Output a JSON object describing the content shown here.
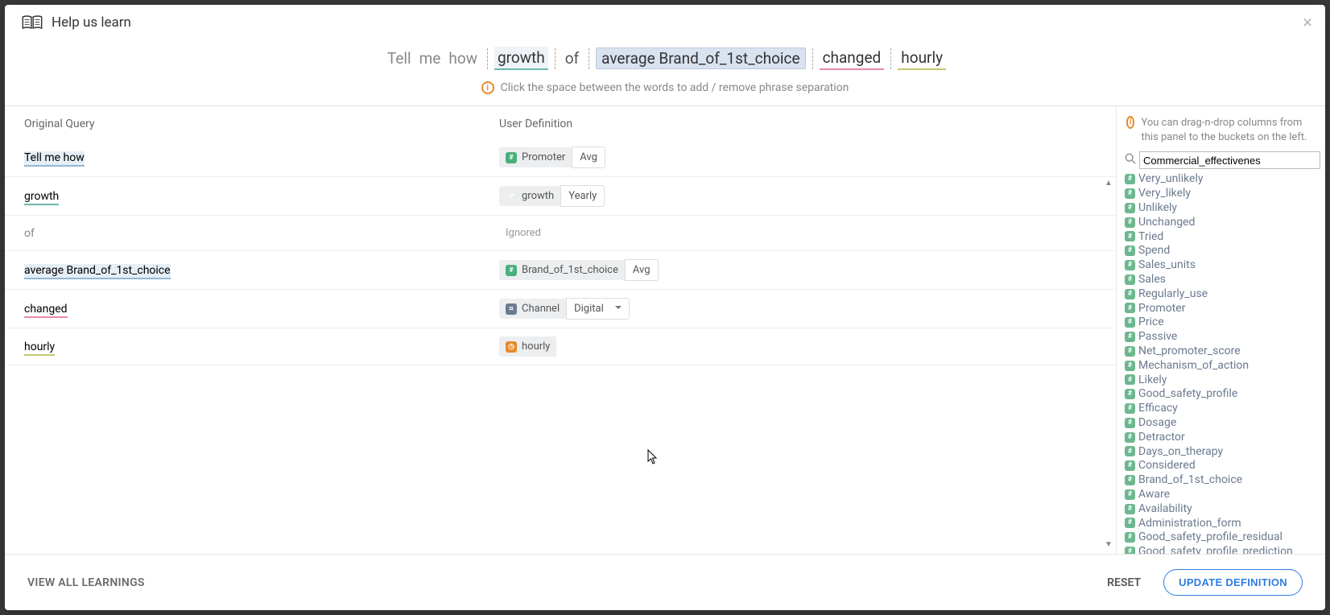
{
  "modal": {
    "title": "Help us learn"
  },
  "query_tokens": {
    "tell": "Tell",
    "me": "me",
    "how": "how",
    "growth": "growth",
    "of": "of",
    "avg": "average  Brand_of_1st_choice",
    "changed": "changed",
    "hourly": "hourly"
  },
  "hint": "Click the space between the words to add / remove phrase separation",
  "headers": {
    "original": "Original Query",
    "user_def": "User Definition"
  },
  "rows": [
    {
      "phrase": "Tell me how",
      "phrase_class": "p-tellme",
      "chip_icon": "i-green",
      "chip_icon_glyph": "#",
      "chip_label": "Promoter",
      "agg": "Avg",
      "agg_caret": false
    },
    {
      "phrase": "growth",
      "phrase_class": "p-growth",
      "chip_icon": "i-chart",
      "chip_icon_glyph": "↗",
      "chip_label": "growth",
      "agg": "Yearly",
      "agg_caret": false
    },
    {
      "phrase": "of",
      "phrase_class": "p-of",
      "ignored": true,
      "ignored_label": "Ignored"
    },
    {
      "phrase": "average Brand_of_1st_choice",
      "phrase_class": "p-avg",
      "chip_icon": "i-green",
      "chip_icon_glyph": "#",
      "chip_label": "Brand_of_1st_choice",
      "agg": "Avg",
      "agg_caret": false
    },
    {
      "phrase": "changed",
      "phrase_class": "p-changed",
      "chip_icon": "i-att",
      "chip_icon_glyph": "⌗",
      "chip_label": "Channel",
      "agg": "Digital",
      "agg_caret": true
    },
    {
      "phrase": "hourly",
      "phrase_class": "p-hourly",
      "chip_icon": "i-orange",
      "chip_icon_glyph": "◷",
      "chip_label": "hourly"
    }
  ],
  "right": {
    "hint": "You can drag-n-drop columns from this panel to the buckets on the left.",
    "search_value": "Commercial_effectivenes",
    "columns": [
      "Very_unlikely",
      "Very_likely",
      "Unlikely",
      "Unchanged",
      "Tried",
      "Spend",
      "Sales_units",
      "Sales",
      "Regularly_use",
      "Promoter",
      "Price",
      "Passive",
      "Net_promoter_score",
      "Mechanism_of_action",
      "Likely",
      "Good_safety_profile",
      "Efficacy",
      "Dosage",
      "Detractor",
      "Days_on_therapy",
      "Considered",
      "Brand_of_1st_choice",
      "Aware",
      "Availability",
      "Administration_form",
      "Good_safety_profile_residual",
      "Good_safety_profile_prediction"
    ]
  },
  "footer": {
    "view_all": "VIEW ALL LEARNINGS",
    "reset": "RESET",
    "update": "UPDATE DEFINITION"
  }
}
